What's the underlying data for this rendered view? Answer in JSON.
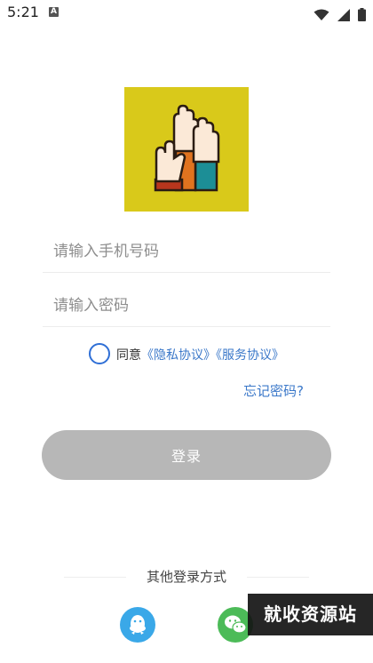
{
  "status_bar": {
    "time": "5:21",
    "notification_glyph": "A",
    "icons": [
      "wifi-icon",
      "signal-icon",
      "battery-icon"
    ]
  },
  "logo": {
    "icon": "raised-hands-logo",
    "background": "#d9c91a"
  },
  "form": {
    "phone_placeholder": "请输入手机号码",
    "password_placeholder": "请输入密码"
  },
  "agreement": {
    "prefix": "同意",
    "privacy_link": "《隐私协议》",
    "service_link": "《服务协议》"
  },
  "forgot_password": "忘记密码?",
  "login_button": "登录",
  "other_login": {
    "title": "其他登录方式",
    "options": [
      "qq-icon",
      "wechat-icon"
    ]
  },
  "watermark": "就收资源站",
  "colors": {
    "accent": "#3b78c9",
    "button_disabled": "#b7b7b7",
    "qq": "#3aa8e8",
    "wechat": "#4cbb58"
  }
}
